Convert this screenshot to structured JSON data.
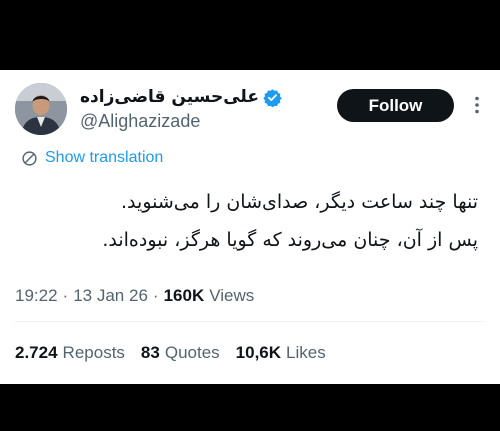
{
  "author": {
    "display_name": "علی‌حسین قاضی‌زاده",
    "handle": "@Alighazizade",
    "verified": true
  },
  "actions": {
    "follow_label": "Follow",
    "more_icon": "ellipsis-icon"
  },
  "translate": {
    "label": "Show translation",
    "icon": "globe-icon"
  },
  "tweet": {
    "lines": [
      "تنها چند ساعت دیگر، صدای‌شان را می‌شنوید.",
      "پس از آن، چنان می‌روند که گویا هرگز، نبوده‌اند."
    ]
  },
  "meta": {
    "time": "19:22",
    "separator": "·",
    "date": "13 Jan 26",
    "views_count": "160K",
    "views_label": "Views"
  },
  "stats": {
    "reposts_count": "2.724",
    "reposts_label": "Reposts",
    "quotes_count": "83",
    "quotes_label": "Quotes",
    "likes_count": "10,6K",
    "likes_label": "Likes"
  },
  "colors": {
    "accent": "#1d9bf0",
    "text": "#0f1419",
    "muted": "#536471",
    "background": "#000000"
  }
}
